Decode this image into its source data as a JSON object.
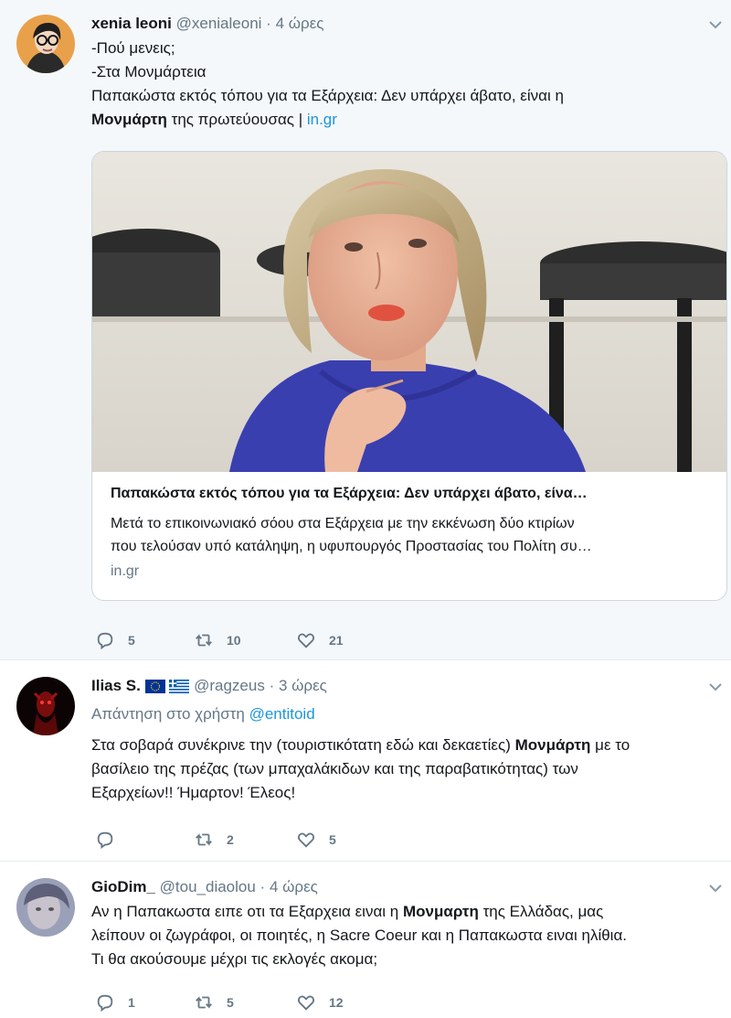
{
  "tweets": [
    {
      "name": "xenia leoni",
      "handle": "@xenialeoni",
      "dot": "·",
      "time": "4 ώρες",
      "lines": [
        "-Πού μενεις;",
        "-Στα Μονμάρτεια",
        "Παπακώστα εκτός τόπου για τα Εξάρχεια: Δεν υπάρχει άβατο, είναι η"
      ],
      "last_bold": "Μονμάρτη",
      "last_rest": " της πρωτεύουσας | ",
      "last_link": "in.gr",
      "card": {
        "title": "Παπακώστα εκτός τόπου για τα Εξάρχεια: Δεν υπάρχει άβατο, είνα…",
        "desc_1": "Μετά το επικοινωνιακό σόου στα Εξάρχεια με την εκκένωση δύο κτιρίων",
        "desc_2": "που τελούσαν υπό κατάληψη, η υφυπουργός Προστασίας του Πολίτη συ…",
        "domain": "in.gr"
      },
      "replies": "5",
      "retweets": "10",
      "likes": "21"
    },
    {
      "name": "Ilias S.",
      "handle": "@ragzeus",
      "dot": "·",
      "time": "3 ώρες",
      "reply_prefix": "Απάντηση στο χρήστη ",
      "reply_user": "@entitoid",
      "l1_pre": "Στα σοβαρά συνέκρινε την (τουριστικότατη εδώ και δεκαετίες) ",
      "l1_bold": "Μονμάρτη",
      "l1_post": " με το",
      "l2": "βασίλειο της πρέζας (των μπαχαλάκιδων και της παραβατικότητας) των",
      "l3": "Εξαρχείων!! Ήμαρτον! Έλεος!",
      "replies": "",
      "retweets": "2",
      "likes": "5"
    },
    {
      "name": "GioDim_",
      "handle": "@tou_diaolou",
      "dot": "·",
      "time": "4 ώρες",
      "l1_pre": "Αν η Παπακωστα ειπε οτι τα Εξαρχεια ειναι η ",
      "l1_bold": "Μονμαρτη",
      "l1_post": " της Ελλάδας, μας",
      "l2": "λείπουν οι ζωγράφοι, οι ποιητές, η Sacre Coeur και η Παπακωστα ειναι ηλίθια.",
      "l3": "Τι θα ακούσουμε μέχρι τις εκλογές ακομα;",
      "replies": "1",
      "retweets": "5",
      "likes": "12"
    }
  ],
  "icons": {
    "reply": "reply-icon",
    "retweet": "retweet-icon",
    "like": "heart-icon",
    "caret": "chevron-down-icon"
  },
  "colors": {
    "link": "#1b95e0",
    "muted": "#657786",
    "border": "#e6ecf0",
    "dress": "#3a3fb0"
  }
}
